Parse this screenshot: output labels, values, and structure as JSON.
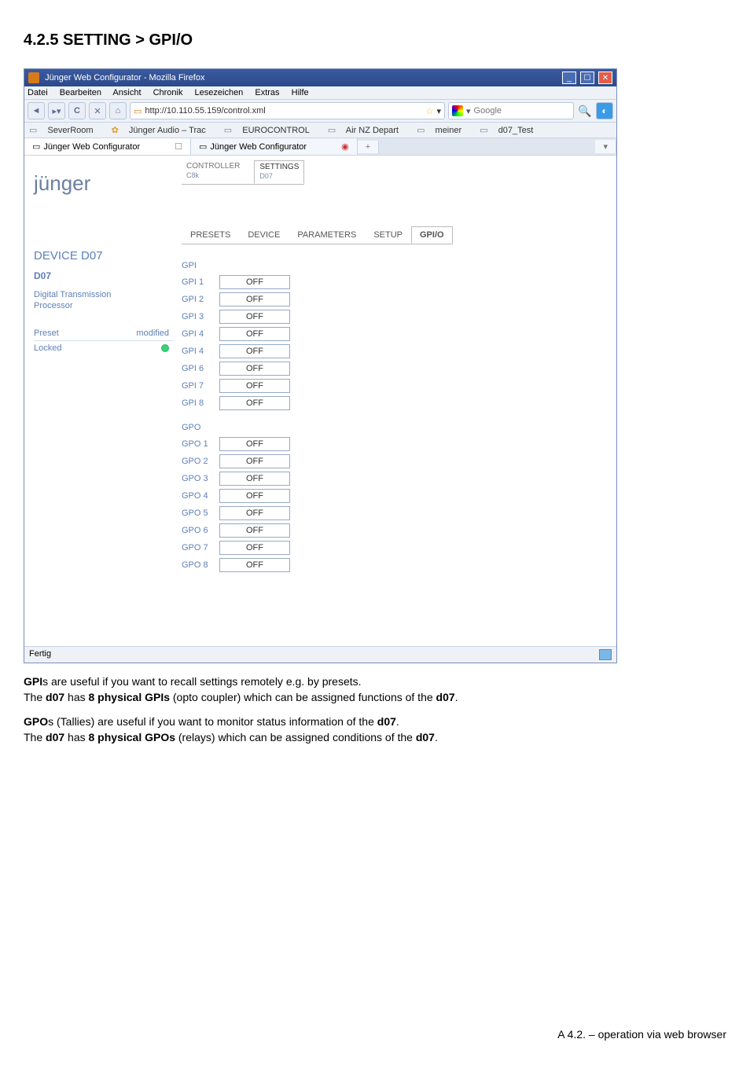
{
  "page": {
    "heading": "4.2.5 SETTING > GPI/O"
  },
  "browser": {
    "title": "Jünger Web Configurator - Mozilla Firefox",
    "menu": [
      "Datei",
      "Bearbeiten",
      "Ansicht",
      "Chronik",
      "Lesezeichen",
      "Extras",
      "Hilfe"
    ],
    "url": "http://10.110.55.159/control.xml",
    "search_placeholder": "Google",
    "bookmarks": [
      "SeverRoom",
      "Jünger Audio – Trac",
      "EUROCONTROL",
      "Air NZ Depart",
      "meiner",
      "d07_Test"
    ],
    "tabs": [
      {
        "label": "Jünger Web Configurator",
        "active": true
      },
      {
        "label": "Jünger Web Configurator",
        "active": false,
        "pinned": true
      }
    ],
    "status": "Fertig"
  },
  "app": {
    "top_tabs": [
      {
        "label": "CONTROLLER",
        "sub": "C8k",
        "active": false
      },
      {
        "label": "SETTINGS",
        "sub": "D07",
        "active": true
      }
    ],
    "logo": "jünger",
    "sub_tabs": [
      "PRESETS",
      "DEVICE",
      "PARAMETERS",
      "SETUP",
      "GPI/O"
    ],
    "sub_tab_selected": "GPI/O",
    "device": {
      "title": "DEVICE D07",
      "subtitle": "D07",
      "desc1": "Digital Transmission",
      "desc2": "Processor",
      "preset_label": "Preset",
      "preset_value": "modified",
      "locked_label": "Locked"
    },
    "gpi": {
      "heading": "GPI",
      "rows": [
        {
          "label": "GPI 1",
          "value": "OFF"
        },
        {
          "label": "GPI 2",
          "value": "OFF"
        },
        {
          "label": "GPI 3",
          "value": "OFF"
        },
        {
          "label": "GPI 4",
          "value": "OFF"
        },
        {
          "label": "GPI 4",
          "value": "OFF"
        },
        {
          "label": "GPI 6",
          "value": "OFF"
        },
        {
          "label": "GPI 7",
          "value": "OFF"
        },
        {
          "label": "GPI 8",
          "value": "OFF"
        }
      ]
    },
    "gpo": {
      "heading": "GPO",
      "rows": [
        {
          "label": "GPO 1",
          "value": "OFF"
        },
        {
          "label": "GPO 2",
          "value": "OFF"
        },
        {
          "label": "GPO 3",
          "value": "OFF"
        },
        {
          "label": "GPO 4",
          "value": "OFF"
        },
        {
          "label": "GPO 5",
          "value": "OFF"
        },
        {
          "label": "GPO 6",
          "value": "OFF"
        },
        {
          "label": "GPO 7",
          "value": "OFF"
        },
        {
          "label": "GPO 8",
          "value": "OFF"
        }
      ]
    }
  },
  "body_text": {
    "p1_prefix": "GPI",
    "p1_rest": "s are useful if you want to recall settings remotely e.g. by presets.",
    "p2_a": "The ",
    "p2_b": "d07",
    "p2_c": " has ",
    "p2_d": "8 physical GPIs",
    "p2_e": " (opto coupler) which can be assigned functions of the ",
    "p2_f": "d07",
    "p2_g": ".",
    "p3_prefix": "GPO",
    "p3_rest": "s (Tallies) are useful if you want to monitor status information of the ",
    "p3_b": "d07",
    "p3_c": ".",
    "p4_a": "The ",
    "p4_b": "d07",
    "p4_c": " has ",
    "p4_d": "8 physical GPOs",
    "p4_e": " (relays) which can be assigned conditions of the ",
    "p4_f": "d07",
    "p4_g": "."
  },
  "footer": "A 4.2. – operation via web browser"
}
